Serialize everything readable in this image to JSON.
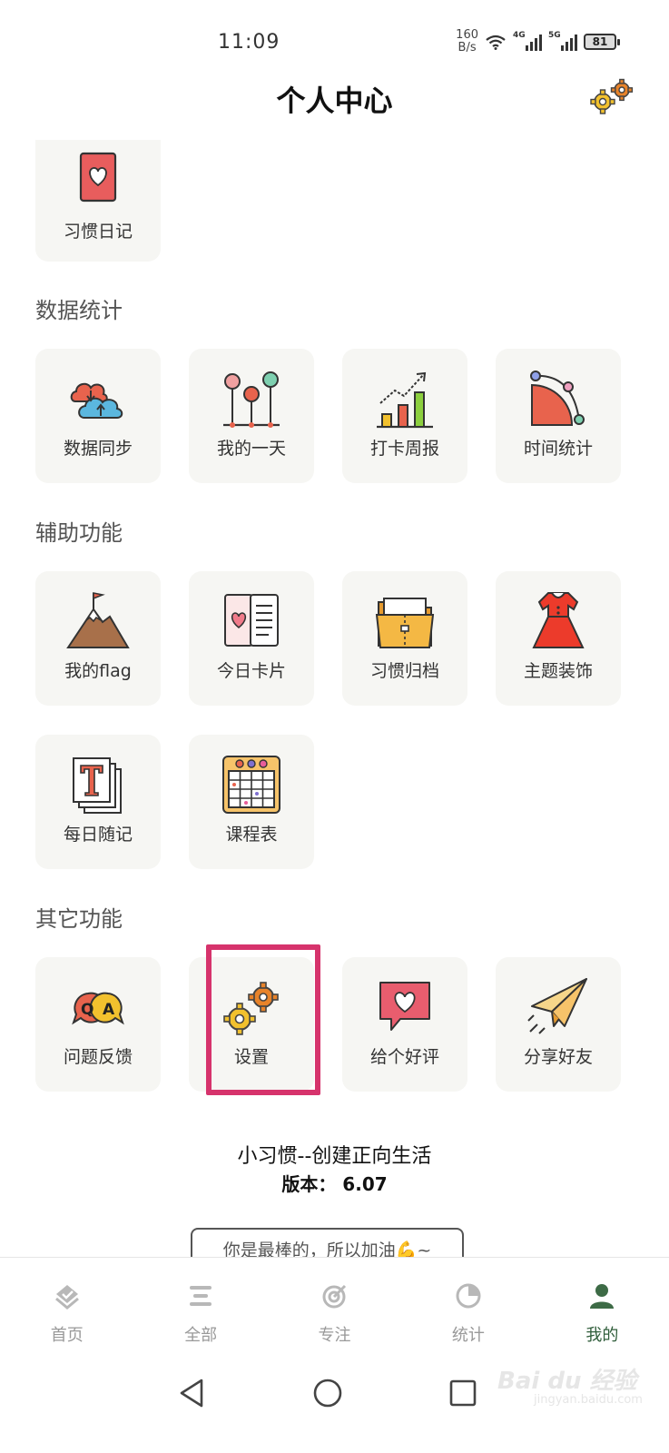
{
  "status": {
    "time": "11:09",
    "net_speed_value": "160",
    "net_speed_unit": "B/s",
    "sig1_tag": "4G",
    "sig2_tag": "5G",
    "battery": "81"
  },
  "header": {
    "title": "个人中心",
    "icon": "gear-icon"
  },
  "top_partial": {
    "label": "习惯日记",
    "icon": "heart-card-icon"
  },
  "sections": {
    "data_stats": {
      "title": "数据统计",
      "items": [
        {
          "label": "数据同步",
          "icon": "cloud-sync-icon"
        },
        {
          "label": "我的一天",
          "icon": "timeline-icon"
        },
        {
          "label": "打卡周报",
          "icon": "bar-growth-icon"
        },
        {
          "label": "时间统计",
          "icon": "pie-curve-icon"
        }
      ]
    },
    "assist": {
      "title": "辅助功能",
      "items": [
        {
          "label": "我的flag",
          "icon": "mountain-flag-icon"
        },
        {
          "label": "今日卡片",
          "icon": "open-card-icon"
        },
        {
          "label": "习惯归档",
          "icon": "folder-icon"
        },
        {
          "label": "主题装饰",
          "icon": "dress-icon"
        },
        {
          "label": "每日随记",
          "icon": "note-t-icon"
        },
        {
          "label": "课程表",
          "icon": "schedule-icon"
        }
      ]
    },
    "other": {
      "title": "其它功能",
      "items": [
        {
          "label": "问题反馈",
          "icon": "qa-bubble-icon"
        },
        {
          "label": "设置",
          "icon": "gears-icon"
        },
        {
          "label": "给个好评",
          "icon": "heart-bubble-icon"
        },
        {
          "label": "分享好友",
          "icon": "paper-plane-icon"
        }
      ]
    }
  },
  "footer": {
    "slogan": "小习惯--创建正向生活",
    "version": "版本：   6.07",
    "cheer": "你是最棒的，所以加油💪~"
  },
  "bottom_nav": {
    "items": [
      {
        "label": "首页",
        "icon": "home-layers-icon"
      },
      {
        "label": "全部",
        "icon": "menu-icon"
      },
      {
        "label": "专注",
        "icon": "target-icon"
      },
      {
        "label": "统计",
        "icon": "pie-chart-icon"
      },
      {
        "label": "我的",
        "icon": "person-icon"
      }
    ],
    "active_color": "#2f5d3a",
    "inactive_color": "#999999"
  },
  "watermark": {
    "text": "Bai du 经验",
    "sub": "jingyan.baidu.com"
  },
  "colors": {
    "card_bg": "#f6f6f3",
    "highlight": "#d6336c"
  }
}
